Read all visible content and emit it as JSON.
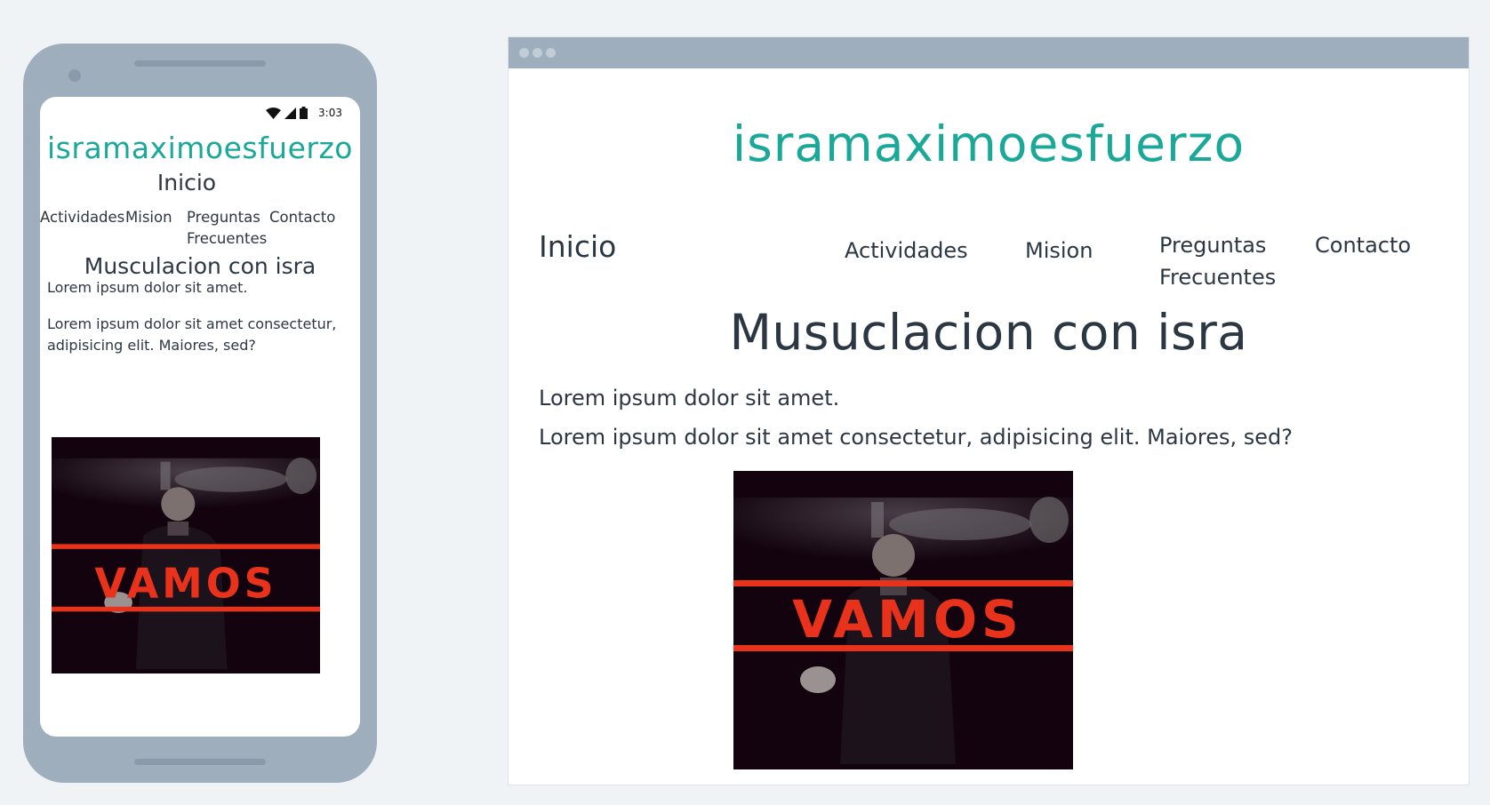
{
  "site": {
    "brand": "isramaximoesfuerzo",
    "nav_home": "Inicio",
    "nav_items": [
      "Actividades",
      "Mision",
      "Preguntas Frecuentes",
      "Contacto"
    ],
    "nav_faq_line1": "Preguntas",
    "nav_faq_line2": "Frecuentes"
  },
  "mobile": {
    "status_time": "3:03",
    "heading": "Musculacion con isra",
    "para1": "Lorem ipsum dolor sit amet.",
    "para2_line1": "Lorem ipsum dolor sit amet consectetur,",
    "para2_line2": "adipisicing elit. Maiores, sed?"
  },
  "desktop": {
    "heading": "Musuclacion con isra",
    "para1": "Lorem ipsum dolor sit amet.",
    "para2": "Lorem ipsum dolor sit amet consectetur, adipisicing elit. Maiores, sed?"
  },
  "image": {
    "overlay_text": "VAMOS",
    "stripe_color": "#e8321c",
    "background_color": "#12030e"
  },
  "colors": {
    "accent": "#1aa899",
    "device_frame": "#9eaebd",
    "page_background": "#eff3f6"
  }
}
